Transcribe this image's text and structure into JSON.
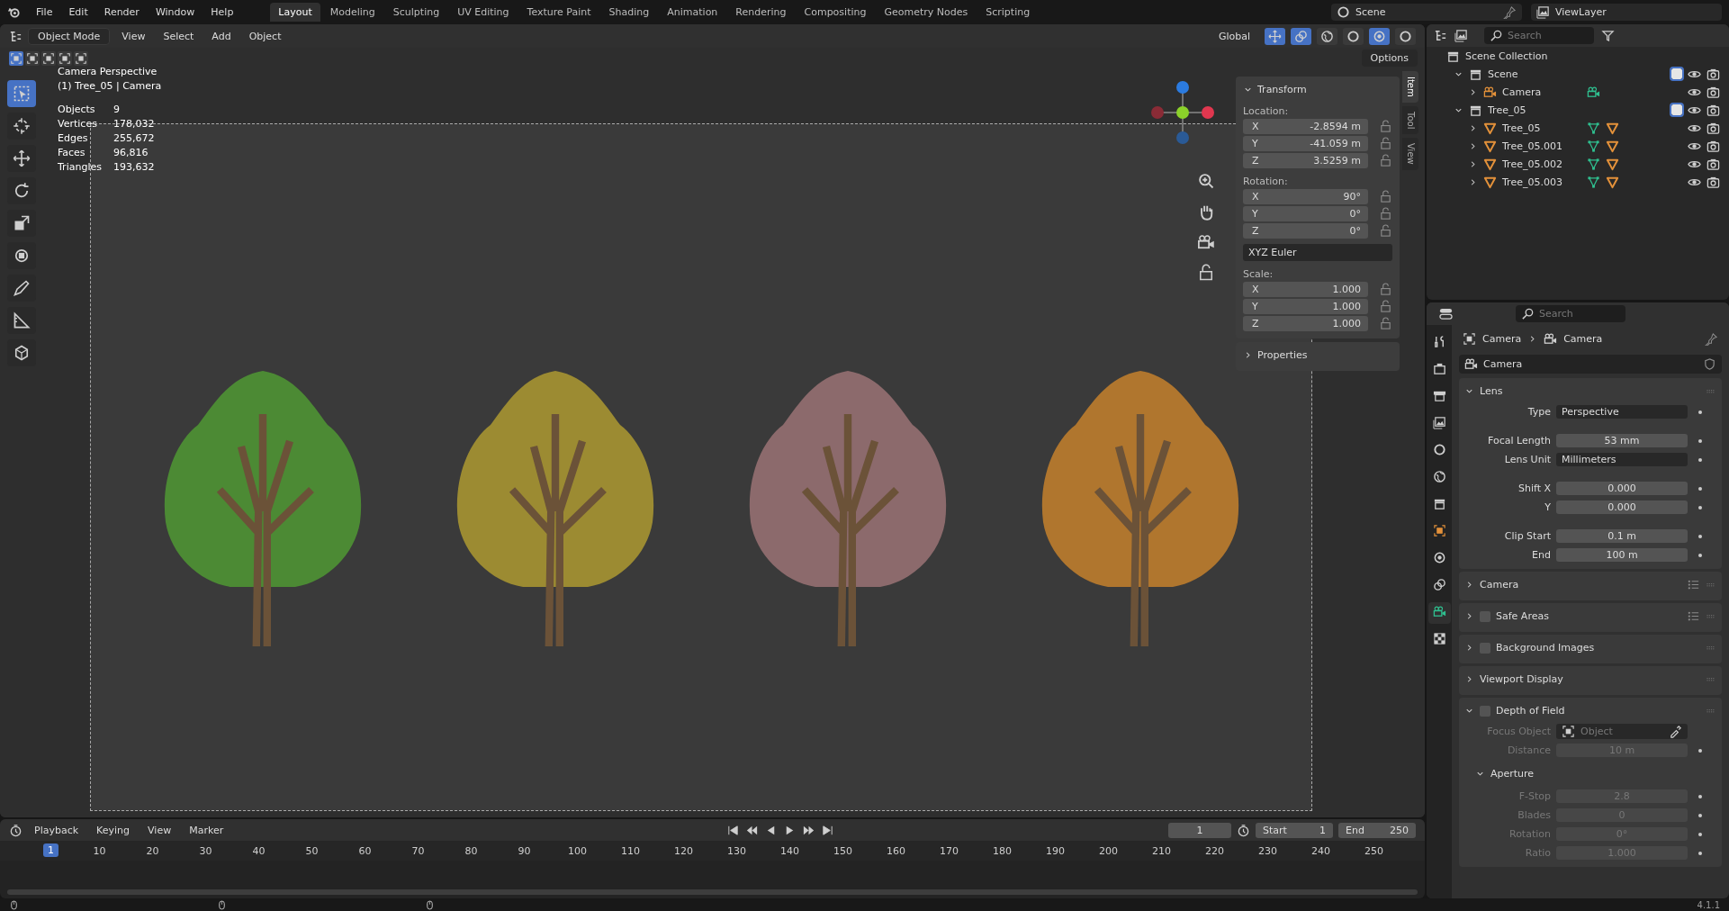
{
  "topbar": {
    "menus": [
      "File",
      "Edit",
      "Render",
      "Window",
      "Help"
    ],
    "workspaces": [
      {
        "label": "Layout",
        "selected": true
      },
      {
        "label": "Modeling",
        "selected": false
      },
      {
        "label": "Sculpting",
        "selected": false
      },
      {
        "label": "UV Editing",
        "selected": false
      },
      {
        "label": "Texture Paint",
        "selected": false
      },
      {
        "label": "Shading",
        "selected": false
      },
      {
        "label": "Animation",
        "selected": false
      },
      {
        "label": "Rendering",
        "selected": false
      },
      {
        "label": "Compositing",
        "selected": false
      },
      {
        "label": "Geometry Nodes",
        "selected": false
      },
      {
        "label": "Scripting",
        "selected": false
      }
    ],
    "scene": "Scene",
    "view_layer": "ViewLayer"
  },
  "viewport_header": {
    "mode": "Object Mode",
    "menus": [
      "View",
      "Select",
      "Add",
      "Object"
    ],
    "orientation": "Global",
    "options": "Options"
  },
  "viewport": {
    "title": "Camera Perspective",
    "subtitle": "(1) Tree_05 | Camera",
    "stats": [
      {
        "label": "Objects",
        "value": "9"
      },
      {
        "label": "Vertices",
        "value": "178,032"
      },
      {
        "label": "Edges",
        "value": "255,672"
      },
      {
        "label": "Faces",
        "value": "96,816"
      },
      {
        "label": "Triangles",
        "value": "193,632"
      }
    ],
    "trees": [
      {
        "color": "#4c8a34"
      },
      {
        "color": "#9c8b32"
      },
      {
        "color": "#8c6a6c"
      },
      {
        "color": "#b0762e"
      }
    ]
  },
  "sidebar_tabs": [
    {
      "label": "Item",
      "selected": true
    },
    {
      "label": "Tool",
      "selected": false
    },
    {
      "label": "View",
      "selected": false
    }
  ],
  "transform": {
    "title": "Transform",
    "groups": [
      {
        "label": "Location:",
        "fields": [
          {
            "axis": "X",
            "value": "-2.8594 m"
          },
          {
            "axis": "Y",
            "value": "-41.059 m"
          },
          {
            "axis": "Z",
            "value": "3.5259 m"
          }
        ]
      },
      {
        "label": "Rotation:",
        "fields": [
          {
            "axis": "X",
            "value": "90°"
          },
          {
            "axis": "Y",
            "value": "0°"
          },
          {
            "axis": "Z",
            "value": "0°"
          }
        ],
        "mode": "XYZ Euler"
      },
      {
        "label": "Scale:",
        "fields": [
          {
            "axis": "X",
            "value": "1.000"
          },
          {
            "axis": "Y",
            "value": "1.000"
          },
          {
            "axis": "Z",
            "value": "1.000"
          }
        ]
      }
    ],
    "properties": "Properties"
  },
  "outliner": {
    "search_placeholder": "Search",
    "root": "Scene Collection",
    "items": [
      {
        "label": "Scene",
        "kind": "collection",
        "expanded": true,
        "checked": true,
        "children": [
          {
            "label": "Camera",
            "kind": "camera",
            "expanded": false
          }
        ]
      },
      {
        "label": "Tree_05",
        "kind": "collection",
        "expanded": true,
        "checked": true,
        "children": [
          {
            "label": "Tree_05",
            "kind": "mesh",
            "expanded": false
          },
          {
            "label": "Tree_05.001",
            "kind": "mesh",
            "expanded": false
          },
          {
            "label": "Tree_05.002",
            "kind": "mesh",
            "expanded": false
          },
          {
            "label": "Tree_05.003",
            "kind": "mesh",
            "expanded": false
          }
        ]
      }
    ]
  },
  "properties": {
    "search_placeholder": "Search",
    "breadcrumb": [
      "Camera",
      "Camera"
    ],
    "datablock": "Camera",
    "panels": [
      {
        "title": "Lens",
        "expanded": true,
        "groups": [
          [
            {
              "label": "Type",
              "kind": "dropdown",
              "value": "Perspective",
              "disabled": false
            }
          ],
          [
            {
              "label": "Focal Length",
              "kind": "number",
              "value": "53 mm",
              "disabled": false
            },
            {
              "label": "Lens Unit",
              "kind": "dropdown",
              "value": "Millimeters",
              "disabled": false
            }
          ],
          [
            {
              "label": "Shift X",
              "kind": "number",
              "value": "0.000",
              "disabled": false
            },
            {
              "label": "Y",
              "kind": "number",
              "value": "0.000",
              "disabled": false
            }
          ],
          [
            {
              "label": "Clip Start",
              "kind": "number",
              "value": "0.1 m",
              "disabled": false
            },
            {
              "label": "End",
              "kind": "number",
              "value": "100 m",
              "disabled": false
            }
          ]
        ]
      },
      {
        "title": "Camera",
        "expanded": false,
        "presets": true
      },
      {
        "title": "Safe Areas",
        "expanded": false,
        "checked": false,
        "presets": true
      },
      {
        "title": "Background Images",
        "expanded": false,
        "checked": false
      },
      {
        "title": "Viewport Display",
        "expanded": false
      },
      {
        "title": "Depth of Field",
        "expanded": true,
        "checked": false,
        "groups": [
          [
            {
              "label": "Focus Object",
              "kind": "object",
              "placeholder": "Object",
              "disabled": true
            },
            {
              "label": "Distance",
              "kind": "number",
              "value": "10 m",
              "disabled": true
            }
          ]
        ],
        "subpanel": {
          "title": "Aperture",
          "expanded": true,
          "groups": [
            [
              {
                "label": "F-Stop",
                "kind": "number",
                "value": "2.8",
                "disabled": true
              },
              {
                "label": "Blades",
                "kind": "number",
                "value": "0",
                "disabled": true
              },
              {
                "label": "Rotation",
                "kind": "number",
                "value": "0°",
                "disabled": true
              },
              {
                "label": "Ratio",
                "kind": "number",
                "value": "1.000",
                "disabled": true
              }
            ]
          ]
        }
      }
    ]
  },
  "timeline": {
    "menus": [
      "Playback",
      "Keying",
      "View",
      "Marker"
    ],
    "current_frame": "1",
    "start_label": "Start",
    "start": "1",
    "end_label": "End",
    "end": "250",
    "playhead": "1",
    "ticks": [
      "10",
      "20",
      "30",
      "40",
      "50",
      "60",
      "70",
      "80",
      "90",
      "100",
      "110",
      "120",
      "130",
      "140",
      "150",
      "160",
      "170",
      "180",
      "190",
      "200",
      "210",
      "220",
      "230",
      "240",
      "250"
    ]
  },
  "status_bar": {
    "version": "4.1.1"
  }
}
